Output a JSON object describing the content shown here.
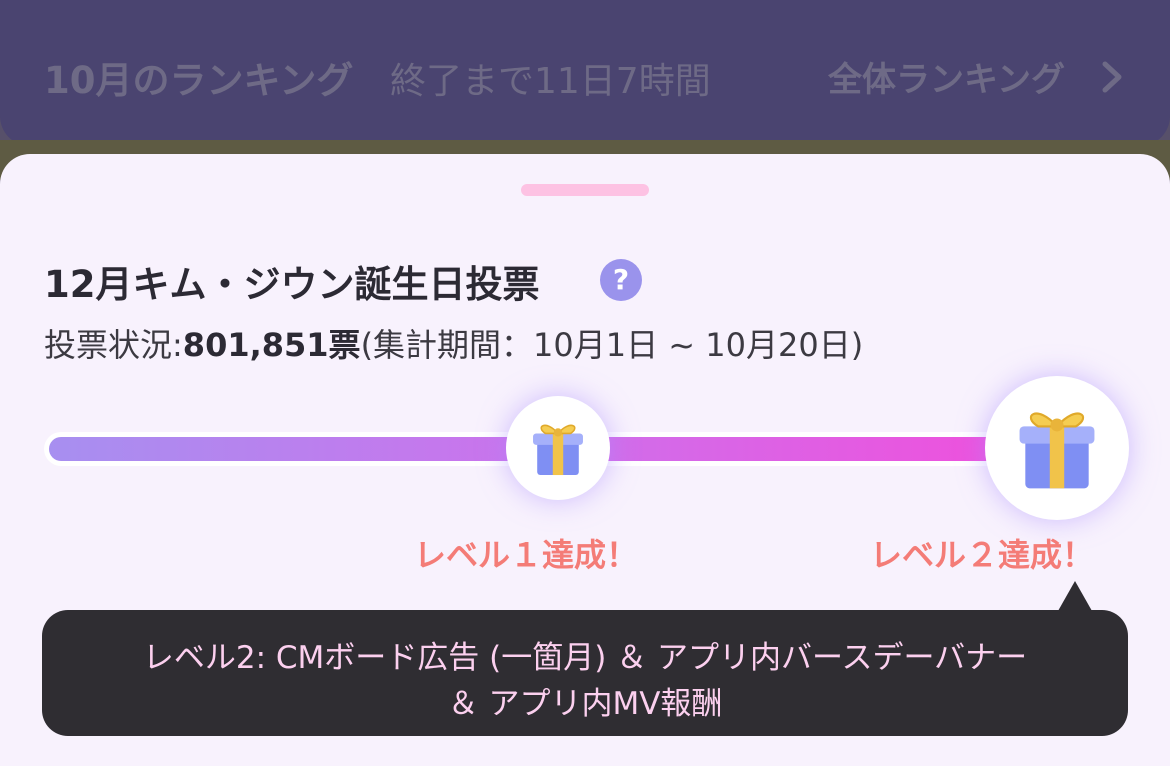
{
  "header": {
    "title": "10月のランキング",
    "countdown": "終了まで11日7時間",
    "all_ranking_link": "全体ランキング",
    "chevron_icon": "chevron-right-icon"
  },
  "vote": {
    "title": "12月キム・ジウン誕生日投票",
    "help_icon": "question-icon",
    "help_glyph": "?",
    "status_label": "投票状況:",
    "status_count": "801,851票",
    "status_period": "(集計期間：10月1日 ~ 10月20日)",
    "progress_fraction": 0.98,
    "levels": [
      {
        "icon": "gift-icon",
        "label": "レベル１達成！"
      },
      {
        "icon": "gift-icon",
        "label": "レベル２達成！"
      }
    ],
    "tooltip": {
      "line1": "レベル2: CMボード広告 (一箇月) ＆ アプリ内バースデーバナー",
      "line2": "＆ アプリ内MV報酬"
    }
  },
  "colors": {
    "sheet_bg": "#f8f2fd",
    "accent_purple": "#a78ff0",
    "accent_pink": "#f04fdc",
    "level_label": "#f47c77",
    "tooltip_bg": "#2f2d32",
    "tooltip_text": "#fcd0ef",
    "handle": "#fdc2e3"
  }
}
